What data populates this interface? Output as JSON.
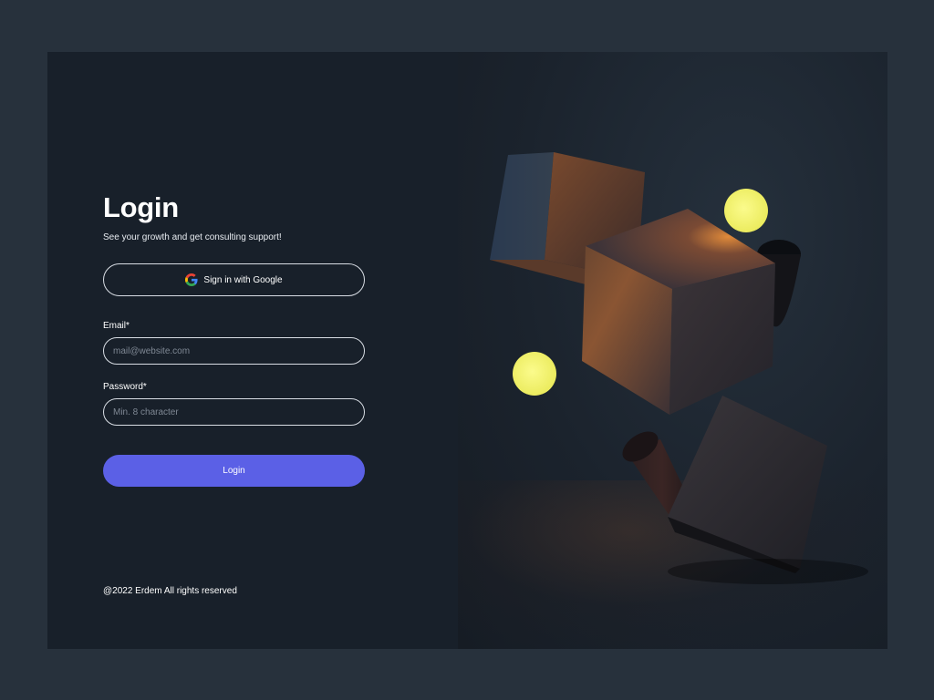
{
  "login": {
    "title": "Login",
    "subtitle": "See your growth and get consulting support!",
    "google_button_label": "Sign in with Google",
    "email_label": "Email*",
    "email_placeholder": "mail@website.com",
    "email_value": "",
    "password_label": "Password*",
    "password_placeholder": "Min. 8 character",
    "password_value": "",
    "submit_label": "Login",
    "footer": "@2022 Erdem All rights reserved"
  },
  "icons": {
    "google": "google-g-icon"
  },
  "colors": {
    "page_background": "#27313c",
    "panel_background": "#18202a",
    "accent": "#5b60e6",
    "field_border": "#d8dde4",
    "sphere_yellow": "#f4f46c"
  }
}
